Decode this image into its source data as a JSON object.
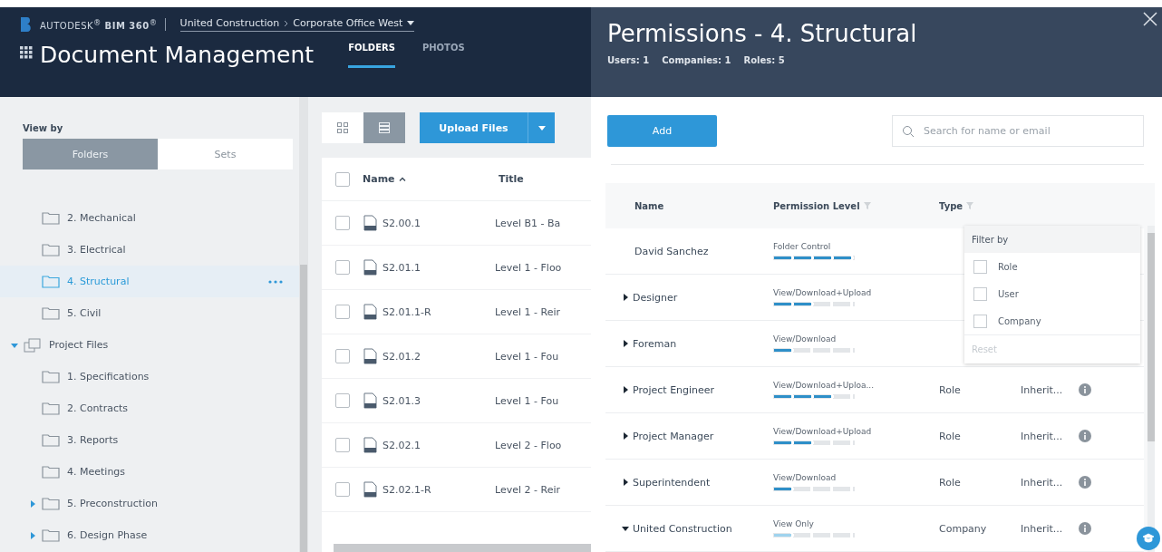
{
  "header": {
    "brand": "AUTODESK$^{®}$ **BIM 360**$^{®}$",
    "breadcrumb": [
      "United Construction",
      "Corporate Office West"
    ],
    "title": "Document Management",
    "tabs": [
      {
        "label": "FOLDERS",
        "selected": true
      },
      {
        "label": "PHOTOS",
        "selected": false
      }
    ]
  },
  "sidebar": {
    "view_by_label": "View by",
    "view_by": [
      {
        "label": "Folders",
        "selected": true
      },
      {
        "label": "Sets",
        "selected": false
      }
    ],
    "tree": [
      {
        "children": [
          {
            "label": "2. Mechanical",
            "kind": "folder",
            "selected": false
          },
          {
            "label": "3. Electrical",
            "kind": "folder",
            "selected": false
          },
          {
            "label": "4. Structural",
            "kind": "folder",
            "selected": true
          },
          {
            "label": "5. Civil",
            "kind": "folder",
            "selected": false
          }
        ]
      },
      {
        "label": "Project Files",
        "kind": "project",
        "selected": false,
        "expanded": true,
        "children": [
          {
            "label": "1. Specifications",
            "kind": "folder",
            "selected": false
          },
          {
            "label": "2. Contracts",
            "kind": "folder",
            "selected": false
          },
          {
            "label": "3. Reports",
            "kind": "folder",
            "selected": false
          },
          {
            "label": "4. Meetings",
            "kind": "folder",
            "selected": false
          },
          {
            "label": "5. Preconstruction",
            "kind": "folder",
            "selected": false,
            "expanded": false
          },
          {
            "label": "6. Design Phase",
            "kind": "folder",
            "selected": false,
            "expanded": false
          }
        ]
      }
    ]
  },
  "files": {
    "view_modes": [
      {
        "kind": "grid",
        "selected": false
      },
      {
        "kind": "list",
        "selected": true
      }
    ],
    "upload_button": "Upload Files",
    "columns": [
      "Name",
      "Title"
    ],
    "all_checked": false,
    "rows": [
      {
        "name": "S2.00.1",
        "title": "Level B1 - Ba",
        "checked": false
      },
      {
        "name": "S2.01.1",
        "title": "Level 1 - Floo",
        "checked": false
      },
      {
        "name": "S2.01.1-R",
        "title": "Level 1 - Reir",
        "checked": false
      },
      {
        "name": "S2.01.2",
        "title": "Level 1 - Fou",
        "checked": false
      },
      {
        "name": "S2.01.3",
        "title": "Level 1 - Fou",
        "checked": false
      },
      {
        "name": "S2.02.1",
        "title": "Level 2 - Floo",
        "checked": false
      },
      {
        "name": "S2.02.1-R",
        "title": "Level 2 - Reir",
        "checked": false
      }
    ]
  },
  "panel": {
    "title": "Permissions - 4. Structural",
    "stats": [
      "Users: 1",
      "Companies: 1",
      "Roles: 5"
    ],
    "add_button": "Add",
    "search": {
      "placeholder": "Search for name or email"
    },
    "columns": [
      "Name",
      "Permission Level",
      "Type"
    ],
    "rows": [
      {
        "name": "David Sanchez",
        "permission": "Folder Control",
        "level": 1
      },
      {
        "name": "Designer",
        "expanded": false,
        "permission": "View/Download+Upload",
        "level": 0.5
      },
      {
        "name": "Foreman",
        "expanded": false,
        "permission": "View/Download",
        "level": 0.25
      },
      {
        "name": "Project Engineer",
        "expanded": false,
        "permission": "View/Download+Uploa...",
        "level": 0.75,
        "type": "Role",
        "inherit": "Inherit..."
      },
      {
        "name": "Project Manager",
        "expanded": false,
        "permission": "View/Download+Upload",
        "level": 0.5,
        "type": "Role",
        "inherit": "Inherit..."
      },
      {
        "name": "Superintendent",
        "expanded": false,
        "permission": "View/Download",
        "level": 0.25,
        "type": "Role",
        "inherit": "Inherit..."
      },
      {
        "name": "United Construction",
        "expanded": true,
        "permission": "View Only",
        "level": 0.25,
        "type": "Company",
        "inherit": "Inherit..."
      }
    ],
    "filter": {
      "title": "Filter by",
      "options": [
        {
          "label": "Role",
          "checked": false
        },
        {
          "label": "User",
          "checked": false
        },
        {
          "label": "Company",
          "checked": false
        }
      ],
      "reset": {
        "label": "Reset",
        "disabled": true
      }
    }
  }
}
